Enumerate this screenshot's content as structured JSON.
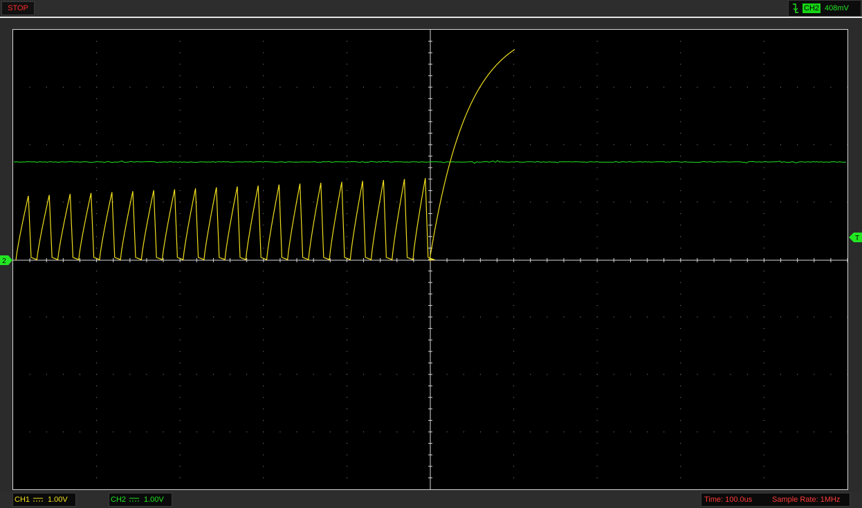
{
  "top": {
    "run_state": "STOP",
    "trigger_channel": "CH2",
    "trigger_level": "408mV",
    "trigger_slope_icon": "falling-edge-icon"
  },
  "markers": {
    "channel_marker": "2",
    "trigger_marker": "T"
  },
  "bottom": {
    "ch1_label": "CH1",
    "ch1_coupling": "DC",
    "ch1_scale": "1.00V",
    "ch2_label": "CH2",
    "ch2_coupling": "DC",
    "ch2_scale": "1.00V",
    "time": "Time: 100.0us",
    "sample_rate": "Sample Rate: 1MHz"
  },
  "colors": {
    "ch1": "#f2e01e",
    "ch2": "#22e622",
    "stop": "#ff2b2b",
    "grid": "#d8d8d8"
  }
}
